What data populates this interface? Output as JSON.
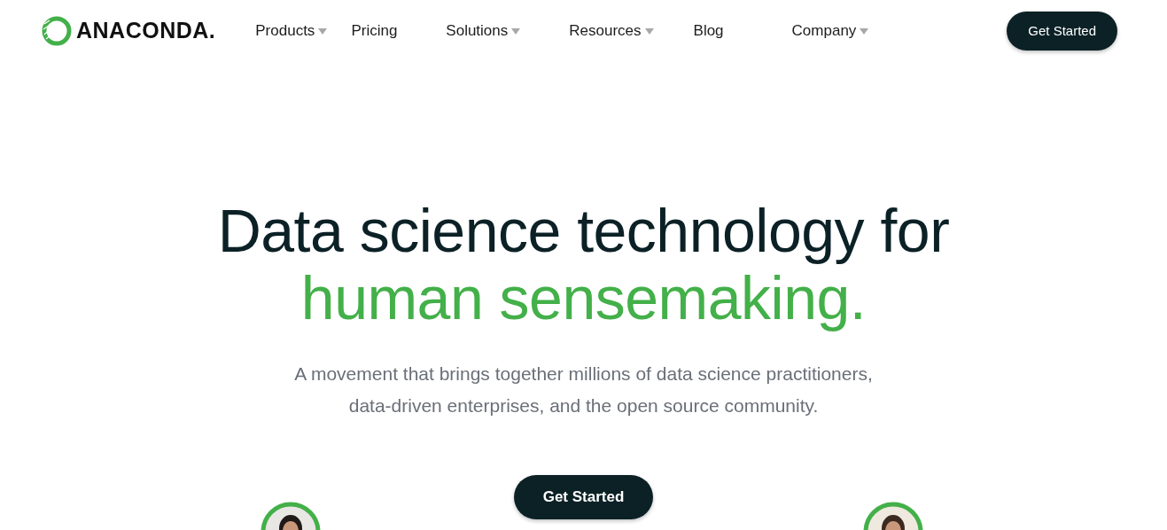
{
  "logo": {
    "text": "ANACONDA."
  },
  "nav": [
    {
      "label": "Products",
      "dropdown": true
    },
    {
      "label": "Pricing",
      "dropdown": false
    },
    {
      "label": "Solutions",
      "dropdown": true
    },
    {
      "label": "Resources",
      "dropdown": true
    },
    {
      "label": "Blog",
      "dropdown": false
    },
    {
      "label": "Company",
      "dropdown": true
    }
  ],
  "header_button": "Get Started",
  "hero": {
    "title_line_1": "Data science technology for",
    "title_line_2": "human sensemaking.",
    "subtitle_line_1": "A movement that brings together millions of data science practitioners,",
    "subtitle_line_2": "data-driven enterprises, and the open source community.",
    "button": "Get Started"
  }
}
